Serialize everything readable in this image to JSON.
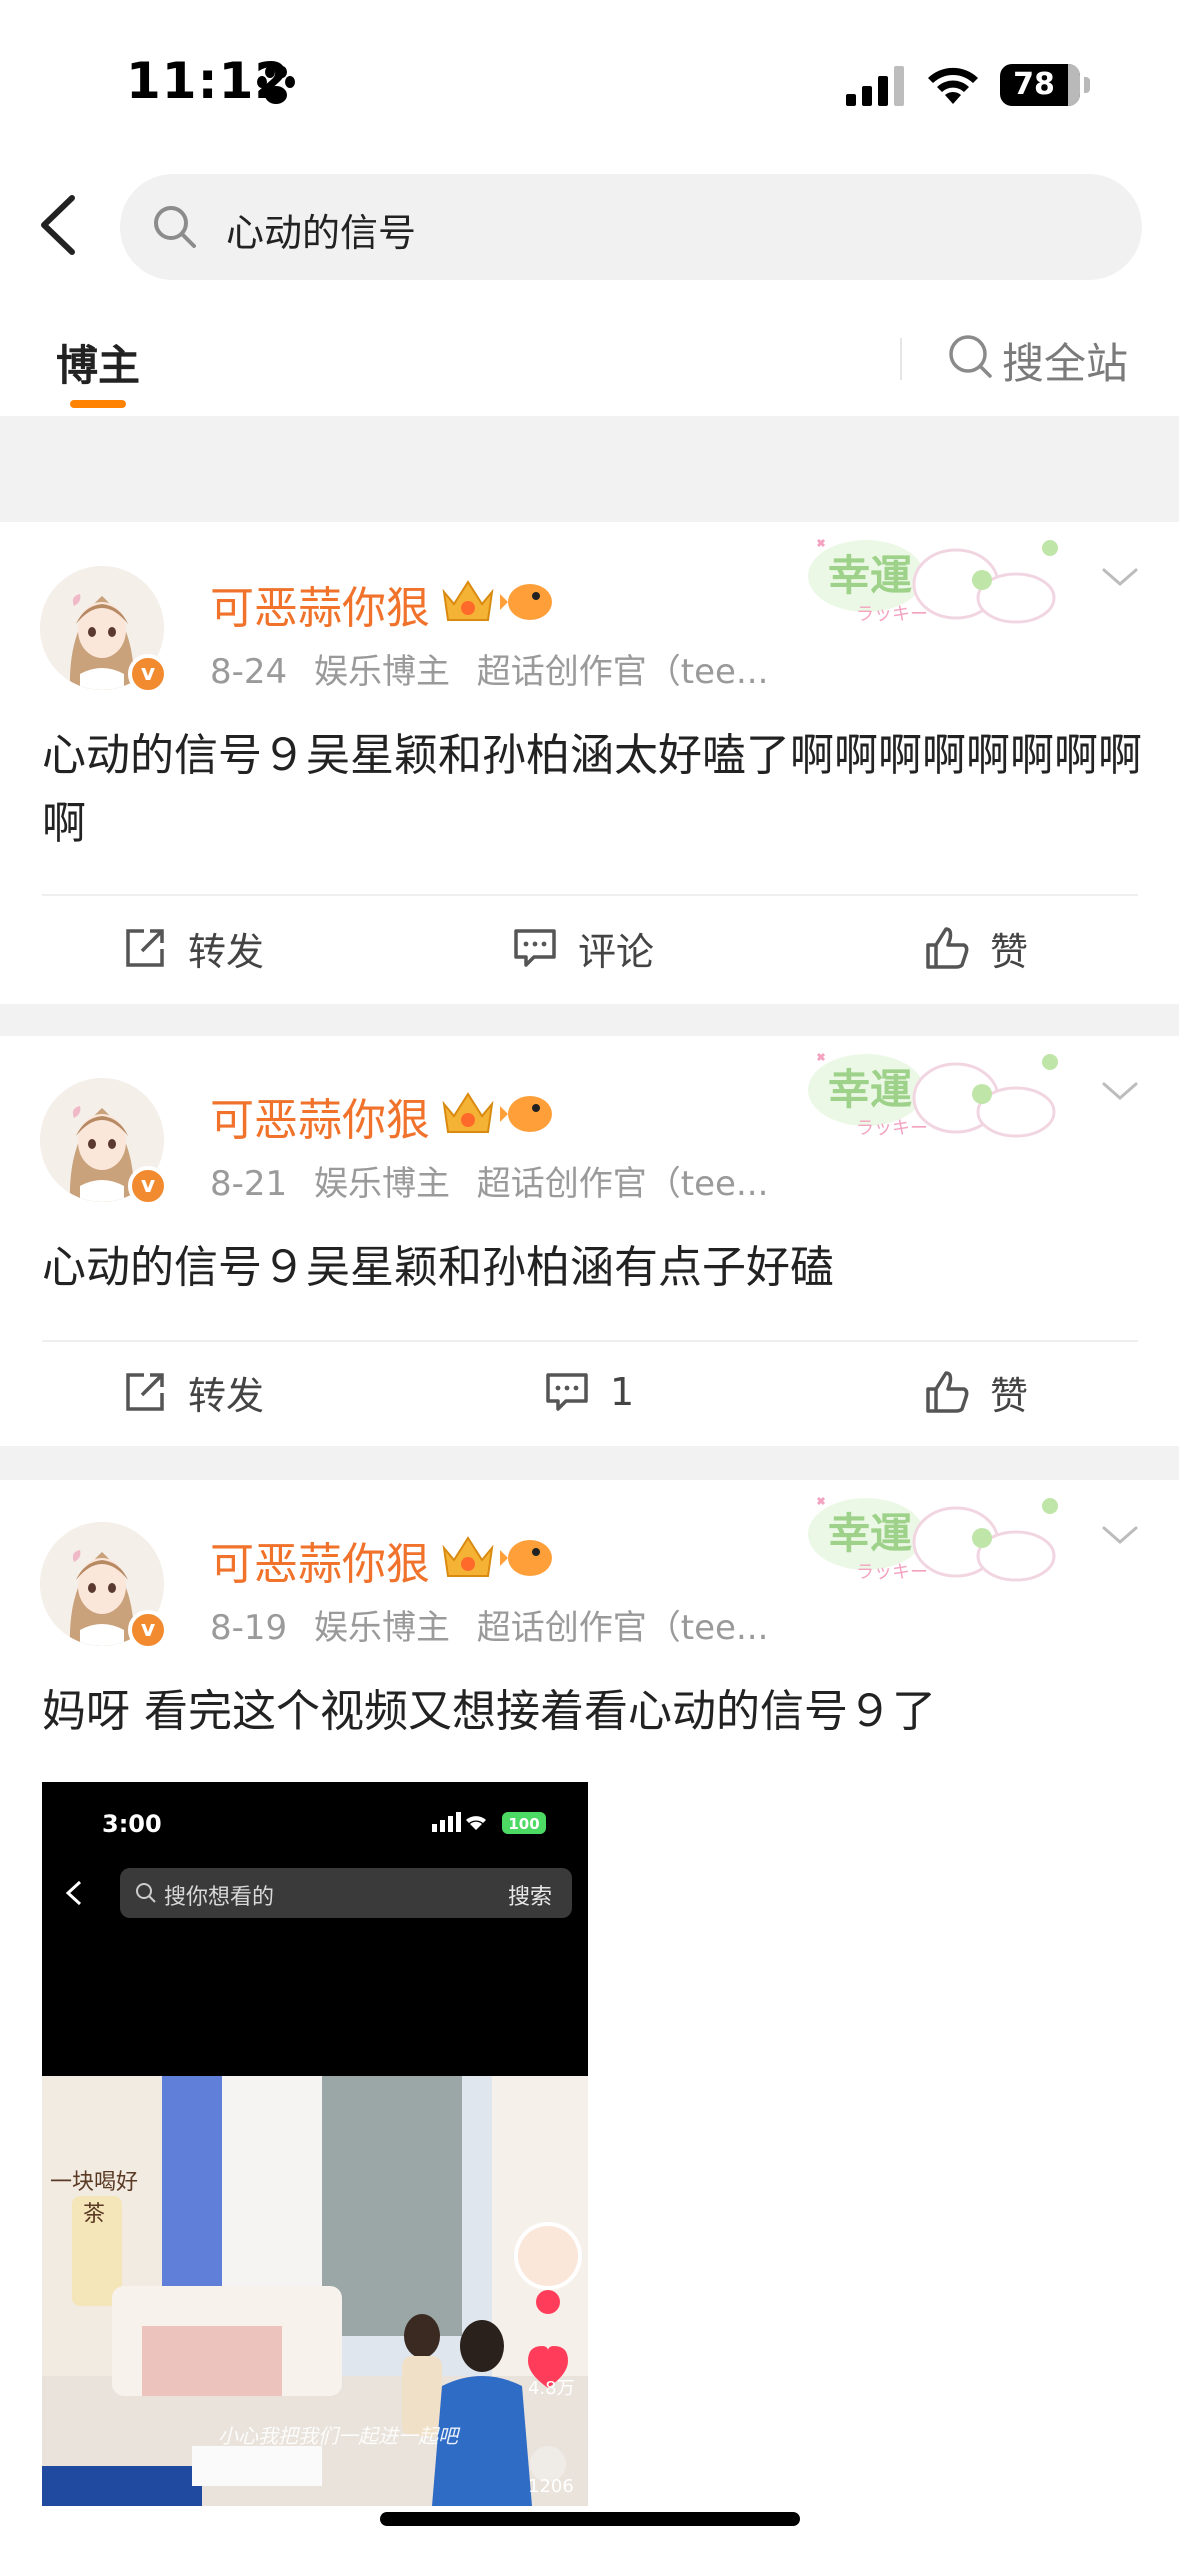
{
  "status_bar": {
    "time": "11:12",
    "battery": "78",
    "battery_level": 0.78
  },
  "search": {
    "query": "心动的信号"
  },
  "tabs": {
    "active": "博主",
    "site_search": "搜全站"
  },
  "colors": {
    "accent": "#ff8200",
    "username": "#f0722b",
    "muted": "#9a9a9a"
  },
  "decor": {
    "lucky_text": "幸運",
    "lucky_sub": "ラッキー"
  },
  "posts": [
    {
      "username": "可恶蒜你狠",
      "date": "8-24",
      "tags": [
        "娱乐博主",
        "超话创作官（tee..."
      ],
      "text": "心动的信号９吴星颖和孙柏涵太好嗑了啊啊啊啊啊啊啊啊啊",
      "actions": {
        "repost": "转发",
        "comment": "评论",
        "like": "赞"
      }
    },
    {
      "username": "可恶蒜你狠",
      "date": "8-21",
      "tags": [
        "娱乐博主",
        "超话创作官（tee..."
      ],
      "text": "心动的信号９吴星颖和孙柏涵有点子好磕",
      "actions": {
        "repost": "转发",
        "comment": "1",
        "like": "赞"
      }
    },
    {
      "username": "可恶蒜你狠",
      "date": "8-19",
      "tags": [
        "娱乐博主",
        "超话创作官（tee..."
      ],
      "text": "妈呀 看完这个视频又想接着看心动的信号９了",
      "video": {
        "time": "3:00",
        "battery": "100",
        "search_placeholder": "搜你想看的",
        "search_button": "搜索",
        "likes": "4.8万",
        "comments": "1206",
        "sign": "一块喝好茶",
        "caption": "小心我把我们一起进一起吧"
      }
    }
  ]
}
